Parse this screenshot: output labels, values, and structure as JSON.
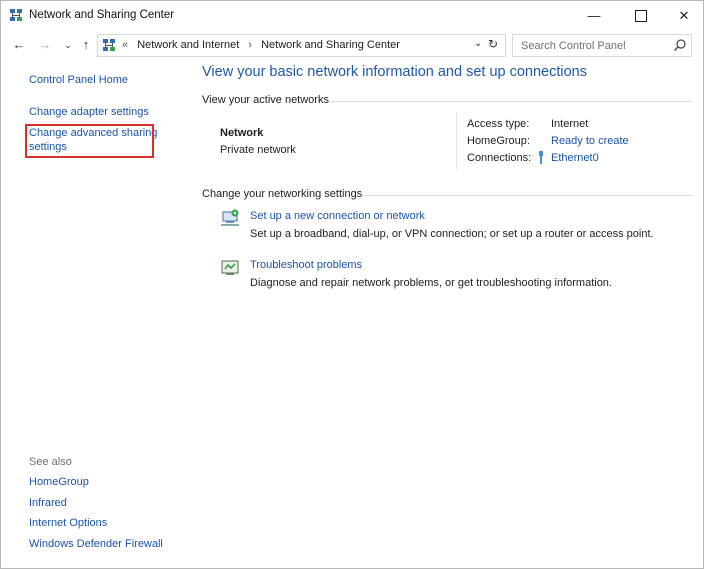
{
  "window": {
    "title": "Network and Sharing Center"
  },
  "address_bar": {
    "overflow": "«",
    "crumbs": [
      "Network and Internet",
      "Network and Sharing Center"
    ],
    "separator": "›"
  },
  "search": {
    "placeholder": "Search Control Panel"
  },
  "left_pane": {
    "home": "Control Panel Home",
    "links": [
      "Change adapter settings",
      "Change advanced sharing",
      "settings"
    ],
    "see_also_title": "See also",
    "see_also": [
      "HomeGroup",
      "Infrared",
      "Internet Options",
      "Windows Defender Firewall"
    ]
  },
  "main": {
    "heading": "View your basic network information and set up connections",
    "active_networks_title": "View your active networks",
    "network": {
      "name": "Network",
      "type": "Private network"
    },
    "access_type_label": "Access type:",
    "access_type_value": "Internet",
    "homegroup_label": "HomeGroup:",
    "homegroup_value": "Ready to create",
    "connections_label": "Connections:",
    "connections_value": "Ethernet0",
    "change_settings_title": "Change your networking settings",
    "tasks": [
      {
        "link": "Set up a new connection or network",
        "desc": "Set up a broadband, dial-up, or VPN connection; or set up a router or access point.",
        "icon": "network-setup-icon"
      },
      {
        "link": "Troubleshoot problems",
        "desc": "Diagnose and repair network problems, or get troubleshooting information.",
        "icon": "troubleshoot-icon"
      }
    ]
  },
  "colors": {
    "link": "#1a54a7",
    "heading": "#1e5aa8",
    "highlight": "#d9302c"
  }
}
